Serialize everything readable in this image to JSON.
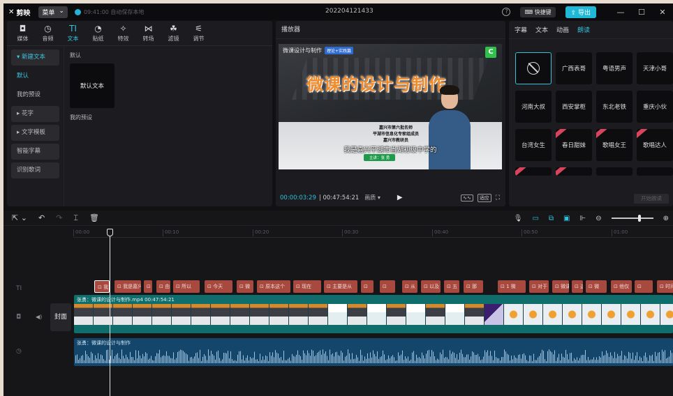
{
  "titlebar": {
    "app_name": "剪映",
    "menu_label": "菜单",
    "autosave": "09:41:00 自动保存本地",
    "project_title": "202204121433",
    "shortcut_label": "快捷键",
    "export_label": "导出"
  },
  "toolbar": {
    "tabs": [
      {
        "label": "媒体",
        "icon": "media-icon"
      },
      {
        "label": "音频",
        "icon": "audio-icon"
      },
      {
        "label": "文本",
        "icon": "text-icon"
      },
      {
        "label": "贴纸",
        "icon": "sticker-icon"
      },
      {
        "label": "特效",
        "icon": "effects-icon"
      },
      {
        "label": "转场",
        "icon": "transition-icon"
      },
      {
        "label": "滤镜",
        "icon": "filter-icon"
      },
      {
        "label": "调节",
        "icon": "adjust-icon"
      }
    ],
    "active": "文本"
  },
  "text_panel": {
    "nav": [
      "新建文本",
      "默认",
      "我的预设",
      "花字",
      "文字模板",
      "智能字幕",
      "识别歌词"
    ],
    "section_default": "默认",
    "default_card": "默认文本",
    "section_preset": "我的预设"
  },
  "player": {
    "title": "播放器",
    "video": {
      "corner_text": "微课设计与制作",
      "badge": "理论+实践篇",
      "logo": "C",
      "headline": "微课的设计与制作",
      "info_lines": [
        "嘉兴市第六批名师",
        "平湖市信息化专家组成员",
        "嘉兴市教研员"
      ],
      "subtitle": "我是嘉兴平湖市当湖初级中学的",
      "namebar": "主讲：张 勇"
    },
    "current_time": "00:00:03:29",
    "total_time": "00:47:54:21",
    "quality": "画质",
    "fit_label": "适应"
  },
  "right_panel": {
    "tabs": [
      "字幕",
      "文本",
      "动画",
      "朗读"
    ],
    "active_tab": "朗读",
    "voices": [
      "",
      "广西表哥",
      "粤语男声",
      "天津小哥",
      "河南大叔",
      "西安掌柜",
      "东北老铁",
      "重庆小伙",
      "台湾女生",
      "春日甜妹",
      "歌唱女王",
      "歌唱达人"
    ],
    "start_button": "开始朗读"
  },
  "timeline": {
    "ruler": [
      "00:00",
      "00:10",
      "00:20",
      "00:30",
      "00:40",
      "00:50",
      "01:00"
    ],
    "text_clips": [
      "我",
      "我是嘉兴",
      "平",
      "由",
      "所以",
      "今天",
      "微",
      "原本这个",
      "现在",
      "主要是从",
      "",
      "",
      "从",
      "以及",
      "五",
      "那",
      "1 微",
      "对于",
      "微课",
      "这",
      "微",
      "他仅",
      "",
      "时间"
    ],
    "cover_label": "封面",
    "video_clip_label": "张勇：微课的设计与制作.mp4   00:47:54:21",
    "audio_clip_label": "张勇：微课的设计与制作"
  }
}
